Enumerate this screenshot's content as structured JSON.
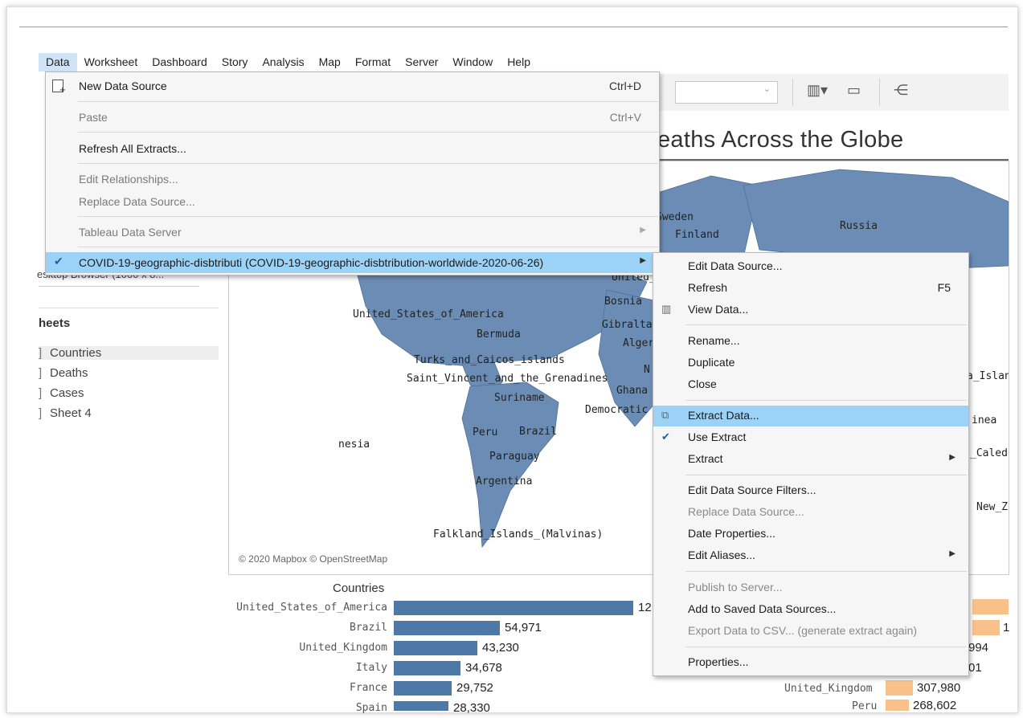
{
  "menubar": {
    "items": [
      "Data",
      "Worksheet",
      "Dashboard",
      "Story",
      "Analysis",
      "Map",
      "Format",
      "Server",
      "Window",
      "Help"
    ],
    "active": "Data"
  },
  "dashboard": {
    "title": "eaths Across the Globe",
    "left_fragment_device": "esktop Browser (1000 x 8...",
    "sheets_heading": "heets",
    "sheets": [
      "Countries",
      "Deaths",
      "Cases",
      "Sheet 4"
    ]
  },
  "map": {
    "attribution": "© 2020 Mapbox © OpenStreetMap",
    "labels": [
      "Sweden",
      "Finland",
      "Russia",
      "United_States_of_America",
      "Bermuda",
      "Turks_and_Caicos_islands",
      "Saint_Vincent_and_the_Grenadines",
      "Suriname",
      "Peru",
      "Brazil",
      "Paraguay",
      "Argentina",
      "Falkland_Islands_(Malvinas)",
      "Bosnia",
      "Gibraltar",
      "Alger",
      "Ghana",
      "Democratic",
      "nesia",
      "United_K",
      "a_Islan",
      "inea",
      "_Caledo",
      "New_Ze",
      "N"
    ]
  },
  "countries_chart": {
    "title": "Countries",
    "categories": [
      "United_States_of_America",
      "Brazil",
      "United_Kingdom",
      "Italy",
      "France",
      "Spain"
    ],
    "value_labels": [
      "12",
      "54,971",
      "43,230",
      "34,678",
      "29,752",
      "28,330"
    ],
    "values": [
      124000,
      54971,
      43230,
      34678,
      29752,
      28330
    ]
  },
  "right_chart": {
    "rows": [
      {
        "label": "",
        "value": ""
      },
      {
        "label": "",
        "value": "1"
      },
      {
        "label": "",
        "value": "994"
      },
      {
        "label": "",
        "value": "01"
      },
      {
        "label": "United_Kingdom",
        "value": "307,980"
      },
      {
        "label": "Peru",
        "value": "268,602"
      }
    ]
  },
  "data_menu": {
    "new_data_source": {
      "label": "New Data Source",
      "shortcut": "Ctrl+D"
    },
    "paste": {
      "label": "Paste",
      "shortcut": "Ctrl+V"
    },
    "refresh_all": {
      "label": "Refresh All Extracts..."
    },
    "edit_relationships": {
      "label": "Edit Relationships..."
    },
    "replace_data_source": {
      "label": "Replace Data Source..."
    },
    "tableau_data_server": {
      "label": "Tableau Data Server"
    },
    "covid_source": {
      "label": "COVID-19-geographic-disbtributi (COVID-19-geographic-disbtribution-worldwide-2020-06-26)"
    }
  },
  "submenu": {
    "edit_data_source": "Edit Data Source...",
    "refresh": "Refresh",
    "refresh_shortcut": "F5",
    "view_data": "View Data...",
    "rename": "Rename...",
    "duplicate": "Duplicate",
    "close": "Close",
    "extract_data": "Extract Data...",
    "use_extract": "Use Extract",
    "extract": "Extract",
    "edit_filters": "Edit Data Source Filters...",
    "replace_source": "Replace Data Source...",
    "date_properties": "Date Properties...",
    "edit_aliases": "Edit Aliases...",
    "publish": "Publish to Server...",
    "add_saved": "Add to Saved Data Sources...",
    "export_csv": "Export Data to CSV... (generate extract again)",
    "properties": "Properties..."
  },
  "colors": {
    "map_land": "#6b8db5",
    "bar_blue": "#4e79a7",
    "bar_orange": "#f8c18a",
    "menu_highlight": "#9dd2f7",
    "menubar_active": "#cfe4f7"
  }
}
